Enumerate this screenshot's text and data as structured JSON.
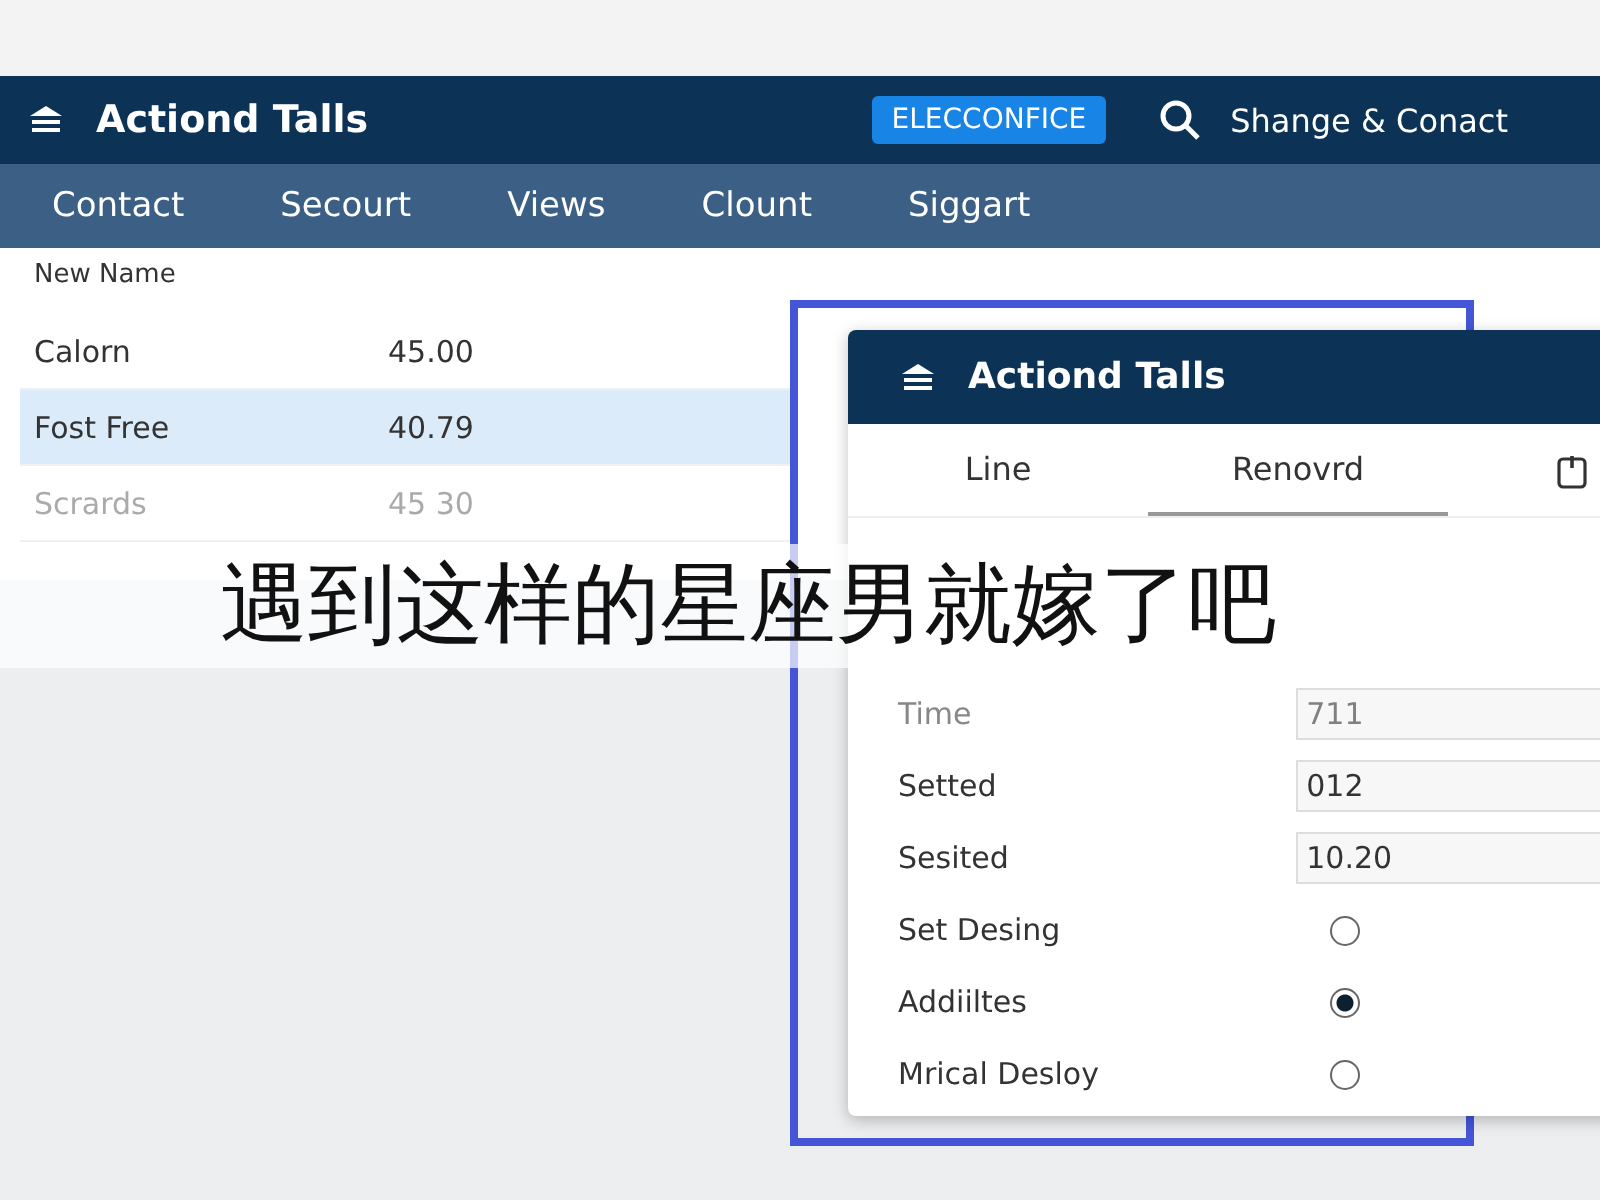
{
  "app": {
    "title": "Actiond Talls",
    "badge": "ELECCONFICE",
    "search_label": "Shange & Conact"
  },
  "nav": [
    {
      "label": "Contact"
    },
    {
      "label": "Secourt"
    },
    {
      "label": "Views"
    },
    {
      "label": "Clount"
    },
    {
      "label": "Siggart"
    }
  ],
  "list": {
    "header": "New Name",
    "rows": [
      {
        "name": "Calorn",
        "value": "45.00",
        "selected": false,
        "disabled": false
      },
      {
        "name": "Fost Free",
        "value": "40.79",
        "selected": true,
        "disabled": false
      },
      {
        "name": "Scrards",
        "value": "45 30",
        "selected": false,
        "disabled": true
      }
    ]
  },
  "dialog": {
    "title": "Actiond Talls",
    "tabs": [
      {
        "label": "Line",
        "selected": false
      },
      {
        "label": "Renovrd",
        "selected": true
      }
    ],
    "fields": [
      {
        "kind": "text",
        "label": "Time",
        "value": "711",
        "disabled": true
      },
      {
        "kind": "text",
        "label": "Setted",
        "value": "012",
        "disabled": false
      },
      {
        "kind": "text",
        "label": "Sesited",
        "value": "10.20",
        "disabled": false
      },
      {
        "kind": "radio",
        "label": "Set Desing",
        "selected": false
      },
      {
        "kind": "radio",
        "label": "Addiiltes",
        "selected": true
      },
      {
        "kind": "radio",
        "label": "Mrical Desloy",
        "selected": false
      }
    ]
  },
  "caption": "遇到这样的星座男就嫁了吧"
}
